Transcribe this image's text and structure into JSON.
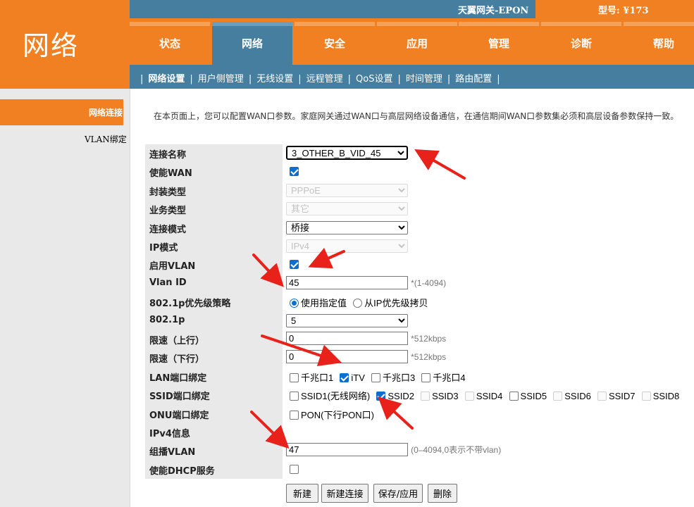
{
  "header": {
    "logo_text": "网络",
    "gateway_name": "天翼网关-EPON",
    "model_label": "型号: ¥173"
  },
  "main_nav": {
    "tabs": [
      {
        "label": "状态",
        "active": false
      },
      {
        "label": "网络",
        "active": true
      },
      {
        "label": "安全",
        "active": false
      },
      {
        "label": "应用",
        "active": false
      },
      {
        "label": "管理",
        "active": false
      },
      {
        "label": "诊断",
        "active": false
      },
      {
        "label": "帮助",
        "active": false
      }
    ]
  },
  "sub_nav": {
    "items": [
      "网络设置",
      "用户侧管理",
      "无线设置",
      "远程管理",
      "QoS设置",
      "时间管理",
      "路由配置"
    ],
    "active_index": 0,
    "separator": "|"
  },
  "sidebar": {
    "items": [
      {
        "label": "网络连接",
        "active": true
      },
      {
        "label": "VLAN绑定",
        "active": false
      }
    ]
  },
  "intro_text": "在本页面上，您可以配置WAN口参数。家庭网关通过WAN口与高层网络设备通信，在通信期间WAN口参数集必须和高层设备参数保持一致。",
  "form": {
    "connection_name": {
      "label": "连接名称",
      "value": "3_OTHER_B_VID_45"
    },
    "enable_wan": {
      "label": "使能WAN",
      "checked": true
    },
    "encapsulation": {
      "label": "封装类型",
      "value": "PPPoE",
      "disabled": true
    },
    "service_type": {
      "label": "业务类型",
      "value": "其它",
      "disabled": true
    },
    "connection_mode": {
      "label": "连接模式",
      "value": "桥接"
    },
    "ip_mode": {
      "label": "IP模式",
      "value": "IPv4",
      "disabled": true
    },
    "enable_vlan": {
      "label": "启用VLAN",
      "checked": true
    },
    "vlan_id": {
      "label": "Vlan ID",
      "value": "45",
      "hint": "*(1-4094)"
    },
    "priority_policy": {
      "label": "802.1p优先级策略",
      "options": [
        {
          "label": "使用指定值",
          "selected": true
        },
        {
          "label": "从IP优先级拷贝",
          "selected": false
        }
      ]
    },
    "priority_8021p": {
      "label": "802.1p",
      "value": "5"
    },
    "rate_up": {
      "label": "限速（上行）",
      "value": "0",
      "hint": "*512kbps"
    },
    "rate_down": {
      "label": "限速（下行）",
      "value": "0",
      "hint": "*512kbps"
    },
    "lan_binding": {
      "label": "LAN端口绑定",
      "ports": [
        {
          "label": "千兆口1",
          "checked": false
        },
        {
          "label": "iTV",
          "checked": true
        },
        {
          "label": "千兆口3",
          "checked": false
        },
        {
          "label": "千兆口4",
          "checked": false
        }
      ]
    },
    "ssid_binding": {
      "label": "SSID端口绑定",
      "ports": [
        {
          "label": "SSID1(无线网络)",
          "checked": false,
          "disabled": false
        },
        {
          "label": "SSID2",
          "checked": true,
          "disabled": false
        },
        {
          "label": "SSID3",
          "checked": false,
          "disabled": true
        },
        {
          "label": "SSID4",
          "checked": false,
          "disabled": true
        },
        {
          "label": "SSID5",
          "checked": false,
          "disabled": false
        },
        {
          "label": "SSID6",
          "checked": false,
          "disabled": true
        },
        {
          "label": "SSID7",
          "checked": false,
          "disabled": true
        },
        {
          "label": "SSID8",
          "checked": false,
          "disabled": true
        }
      ]
    },
    "onu_binding": {
      "label": "ONU端口绑定",
      "port_label": "PON(下行PON口)",
      "checked": false
    },
    "ipv4_info": {
      "label": "IPv4信息"
    },
    "multicast_vlan": {
      "label": "组播VLAN",
      "value": "47",
      "hint": "(0–4094,0表示不带vlan)"
    },
    "enable_dhcp": {
      "label": "使能DHCP服务",
      "checked": false
    }
  },
  "buttons": {
    "new": "新建",
    "new_connection": "新建连接",
    "save_apply": "保存/应用",
    "delete": "删除"
  },
  "colors": {
    "brand_orange": "#f08021",
    "nav_blue": "#467ea0",
    "annotation_red": "#e8211a",
    "checkbox_blue": "#0b6fd1"
  }
}
